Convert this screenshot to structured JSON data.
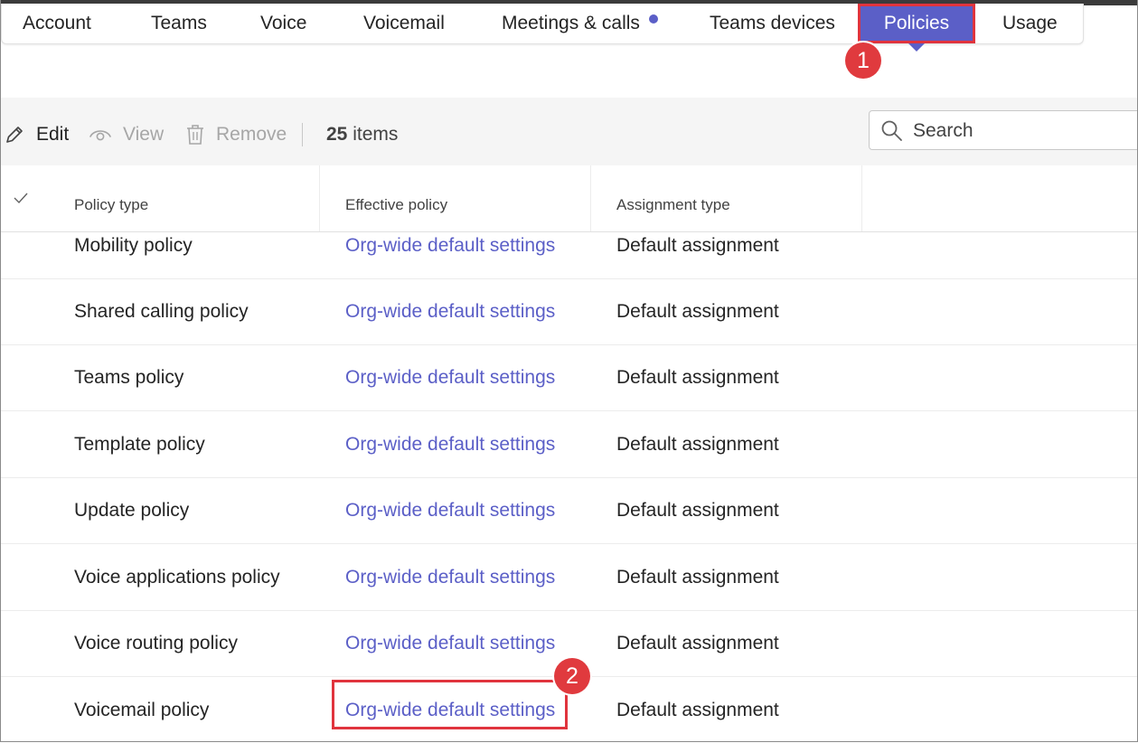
{
  "tabs": [
    {
      "label": "Account",
      "active": false
    },
    {
      "label": "Teams",
      "active": false
    },
    {
      "label": "Voice",
      "active": false
    },
    {
      "label": "Voicemail",
      "active": false
    },
    {
      "label": "Meetings & calls",
      "active": false,
      "has_dot": true
    },
    {
      "label": "Teams devices",
      "active": false
    },
    {
      "label": "Policies",
      "active": true
    },
    {
      "label": "Usage",
      "active": false
    }
  ],
  "markers": {
    "first": "1",
    "second": "2"
  },
  "toolbar": {
    "edit": {
      "label": "Edit",
      "icon": "pencil-icon",
      "enabled": true
    },
    "view": {
      "label": "View",
      "icon": "eye-icon",
      "enabled": false
    },
    "remove": {
      "label": "Remove",
      "icon": "trash-icon",
      "enabled": false
    },
    "count_number": "25",
    "count_suffix": "items"
  },
  "search": {
    "placeholder": "Search",
    "value": ""
  },
  "table": {
    "headers": {
      "policy_type": "Policy type",
      "effective_policy": "Effective policy",
      "assignment_type": "Assignment type"
    },
    "rows": [
      {
        "policy_type": "Mobility policy",
        "effective_policy": "Org-wide default settings",
        "assignment_type": "Default assignment"
      },
      {
        "policy_type": "Shared calling policy",
        "effective_policy": "Org-wide default settings",
        "assignment_type": "Default assignment"
      },
      {
        "policy_type": "Teams policy",
        "effective_policy": "Org-wide default settings",
        "assignment_type": "Default assignment"
      },
      {
        "policy_type": "Template policy",
        "effective_policy": "Org-wide default settings",
        "assignment_type": "Default assignment"
      },
      {
        "policy_type": "Update policy",
        "effective_policy": "Org-wide default settings",
        "assignment_type": "Default assignment"
      },
      {
        "policy_type": "Voice applications policy",
        "effective_policy": "Org-wide default settings",
        "assignment_type": "Default assignment"
      },
      {
        "policy_type": "Voice routing policy",
        "effective_policy": "Org-wide default settings",
        "assignment_type": "Default assignment"
      },
      {
        "policy_type": "Voicemail policy",
        "effective_policy": "Org-wide default settings",
        "assignment_type": "Default assignment"
      }
    ]
  },
  "colors": {
    "accent": "#5b5fc7",
    "annotation": "#e0343d",
    "link": "#5b5fc7"
  }
}
